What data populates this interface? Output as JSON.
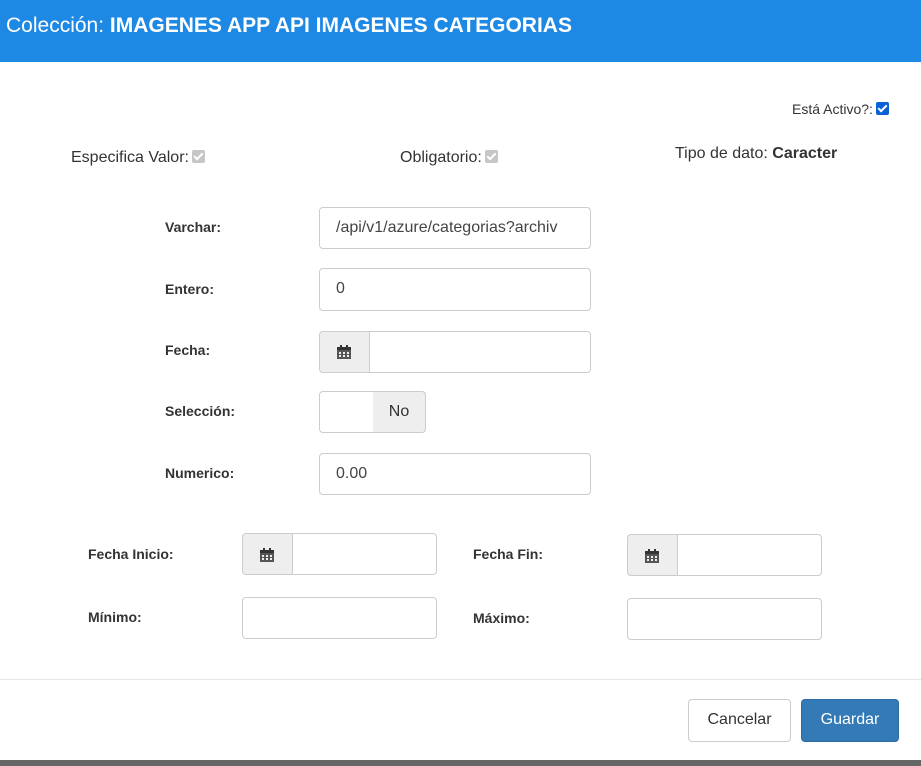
{
  "header": {
    "prefix": "Colección:",
    "collection_name": "IMAGENES APP API IMAGENES CATEGORIAS"
  },
  "flags": {
    "active_label": "Está Activo?:",
    "active_checked": true,
    "specifies_value_label": "Especifica Valor:",
    "specifies_value_checked": true,
    "required_label": "Obligatorio:",
    "required_checked": true,
    "data_type_label": "Tipo de dato:",
    "data_type_value": "Caracter"
  },
  "fields": {
    "varchar_label": "Varchar:",
    "varchar_value": "/api/v1/azure/categorias?archiv",
    "entero_label": "Entero:",
    "entero_value": "0",
    "fecha_label": "Fecha:",
    "fecha_value": "",
    "seleccion_label": "Selección:",
    "seleccion_value": "No",
    "numerico_label": "Numerico:",
    "numerico_value": "0.00"
  },
  "range": {
    "fecha_inicio_label": "Fecha Inicio:",
    "fecha_inicio_value": "",
    "fecha_fin_label": "Fecha Fin:",
    "fecha_fin_value": "",
    "minimo_label": "Mínimo:",
    "minimo_value": "",
    "maximo_label": "Máximo:",
    "maximo_value": ""
  },
  "footer": {
    "cancel_label": "Cancelar",
    "save_label": "Guardar"
  },
  "colors": {
    "header_bg": "#1e88e5",
    "primary_button": "#337ab7",
    "checkbox_active": "#0b61d4"
  },
  "icons": {
    "calendar": "calendar-icon",
    "checkbox": "checkmark-icon"
  }
}
